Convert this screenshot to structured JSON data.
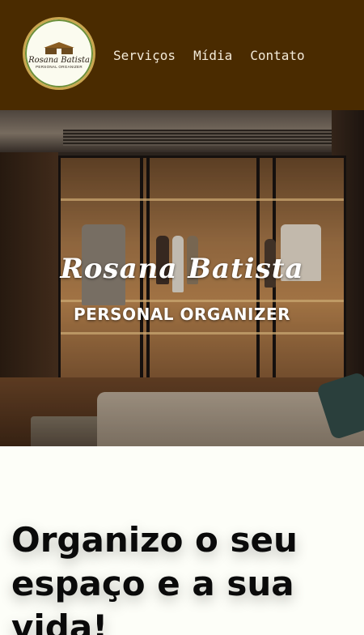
{
  "brand": {
    "logo_script": "Rosana Batista",
    "logo_sub": "PERSONAL ORGANIZER",
    "colors": {
      "header_bg": "#4a2b00",
      "nav_text": "#f3ead8",
      "page_bg": "#fdfef8"
    }
  },
  "nav": {
    "items": [
      {
        "label": "Serviços"
      },
      {
        "label": "Mídia"
      },
      {
        "label": "Contato"
      }
    ]
  },
  "hero": {
    "script_title": "Rosana Batista",
    "subtitle": "PERSONAL ORGANIZER",
    "image_description_icon": "walk-in-closet-photo"
  },
  "main": {
    "headline": "Organizo o seu espaço e a sua vida!"
  }
}
